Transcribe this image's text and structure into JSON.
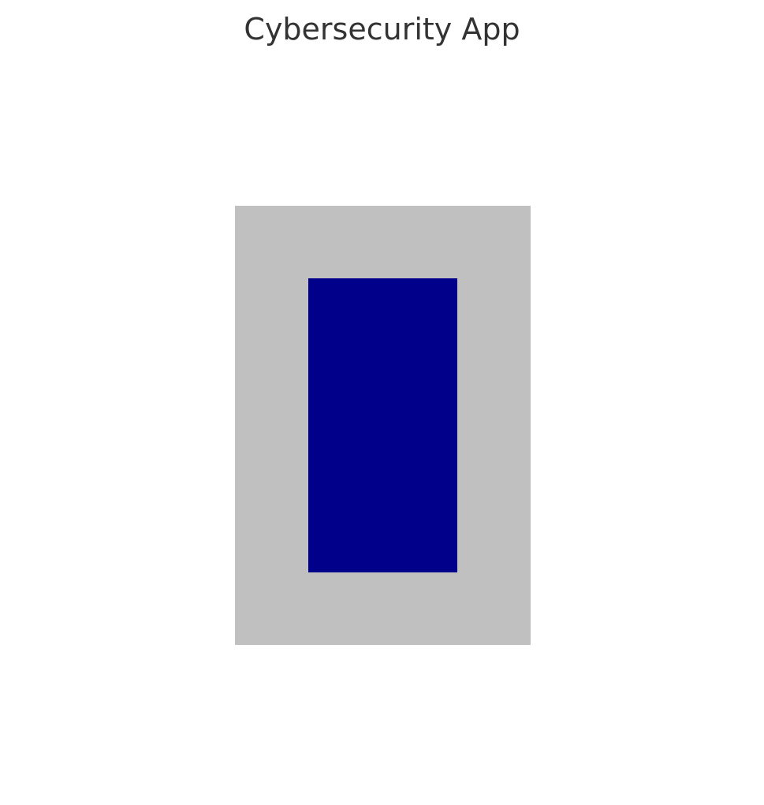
{
  "header": {
    "title": "Cybersecurity App"
  },
  "colors": {
    "frame": "#c0c0c0",
    "screen": "#00008b",
    "title_text": "#333333",
    "background": "#ffffff"
  }
}
